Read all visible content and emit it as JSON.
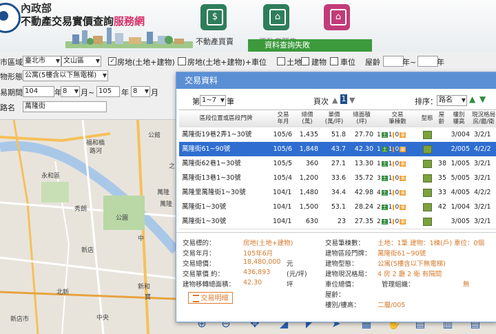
{
  "header": {
    "ministry": "內政部",
    "site_name_a": "不動產交易實價查詢",
    "site_name_b": "服務網",
    "nav": [
      {
        "label": "不動產買賣"
      },
      {
        "label": "不動產預售"
      }
    ],
    "banner": "資料查詢失敗"
  },
  "form": {
    "district_label": "市區域",
    "city": "臺北市",
    "district": "文山區",
    "check_land_building": "房地(土地+建物)",
    "check_land_building_parking": "房地(土地+建物)+車位",
    "check_land": "土地",
    "check_building": "建物",
    "check_parking": "車位",
    "age_label": "屋齡",
    "year_to": "年~",
    "year_unit": "年",
    "type_label": "物形態",
    "type_value": "公寓(5樓含以下無電梯)",
    "period_label": "易期間",
    "year_from_val": "104",
    "month_from_val": "8",
    "year_to_val": "105",
    "month_to_val": "8",
    "nian": "年",
    "yue_tilde": "月~",
    "yue": "月",
    "road_label": "路名",
    "road_value": "萬隆街"
  },
  "map": {
    "labels": [
      "永和區",
      "福和橋",
      "路河",
      "秀朗",
      "公園",
      "新店",
      "中",
      "北新",
      "中央",
      "公館",
      "萬隆",
      "萬隆",
      "之",
      "寶",
      "新店市",
      "新和"
    ]
  },
  "dialog": {
    "title": "交易資料",
    "page_prefix": "第",
    "page_select": "1~7",
    "page_suffix": "筆",
    "page_nav_label": "頁次",
    "page_number": "1",
    "sort_label": "排序：",
    "sort_value": "路名",
    "headers": [
      "區段位置或區段門牌",
      "交易\n年月",
      "總價\n(萬)",
      "單價\n(萬/坪)",
      "總面積\n(坪)",
      "交易\n筆棟數",
      "型態",
      "屋\n齡",
      "樓別\n樓高",
      "現況格局\n房/廳/衛"
    ],
    "rows": [
      {
        "addr": "萬隆街19巷2弄1~30號",
        "date": "105/6",
        "total": "1,435",
        "unit": "51.8",
        "area": "27.70",
        "land": "1",
        "bld": "1",
        "park": "0",
        "age": "",
        "floor": "3/004",
        "layout": "3/2/1",
        "selected": false
      },
      {
        "addr": "萬隆街61~90號",
        "date": "105/6",
        "total": "1,848",
        "unit": "43.7",
        "area": "42.30",
        "land": "1",
        "bld": "1",
        "park": "0",
        "age": "",
        "floor": "2/005",
        "layout": "4/2/2",
        "selected": true
      },
      {
        "addr": "萬隆街62巷1~30號",
        "date": "105/5",
        "total": "360",
        "unit": "27.1",
        "area": "13.30",
        "land": "1",
        "bld": "1",
        "park": "0",
        "age": "38",
        "floor": "1/005",
        "layout": "3/2/1",
        "selected": false
      },
      {
        "addr": "萬隆街13巷1~30號",
        "date": "105/4",
        "total": "1,200",
        "unit": "33.6",
        "area": "35.72",
        "land": "3",
        "bld": "1",
        "park": "0",
        "age": "35",
        "floor": "5/005",
        "layout": "3/2/1",
        "selected": false
      },
      {
        "addr": "萬隆里萬隆街1~30號",
        "date": "104/12",
        "total": "1,480",
        "unit": "34.4",
        "area": "42.98",
        "land": "4",
        "bld": "1",
        "park": "0",
        "age": "33",
        "floor": "4/005",
        "layout": "4/2/2",
        "selected": false
      },
      {
        "addr": "萬隆街1~30號",
        "date": "104/11",
        "total": "1,500",
        "unit": "53.1",
        "area": "28.24",
        "land": "2",
        "bld": "1",
        "park": "0",
        "age": "42",
        "floor": "1/004",
        "layout": "3/2/1",
        "selected": false
      },
      {
        "addr": "萬隆街1~30號",
        "date": "104/10",
        "total": "630",
        "unit": "23",
        "area": "27.35",
        "land": "2",
        "bld": "1",
        "park": "0",
        "age": "",
        "floor": "3/005",
        "layout": "3/2/1",
        "selected": false
      }
    ],
    "badge_land": "土",
    "badge_park": "車",
    "detail": {
      "l1": "交易標的：",
      "v1": "房地(土地+建物)",
      "l2": "交易年月：",
      "v2": "105年6月",
      "l3": "交易總價：",
      "v3": "18,480,000",
      "u3": "元",
      "l4": "交易單價 約：",
      "v4": "436,893",
      "u4": "(元/坪)",
      "l5": "建物移轉總面積：",
      "v5": "42.30",
      "u5": "坪",
      "r1l": "交易筆棟數：",
      "r1v": "土地：1筆 建物：1棟(戶) 車位：0個",
      "r2l": "建物區段門牌：",
      "r2v": "萬隆街61~90號",
      "r3l": "建物型態：",
      "r3v": "公寓(5樓含以下無電梯)",
      "r4l": "建物現況格局：",
      "r4v": "4 房 2 廳 2 衛 有隔間",
      "r5l": "車位總價：",
      "r5m": "管理組織：",
      "r5v": "無",
      "r6l": "屋齡：",
      "r7l": "樓別/樓高：",
      "r7v": "二層/005",
      "button": "交易明細"
    }
  }
}
